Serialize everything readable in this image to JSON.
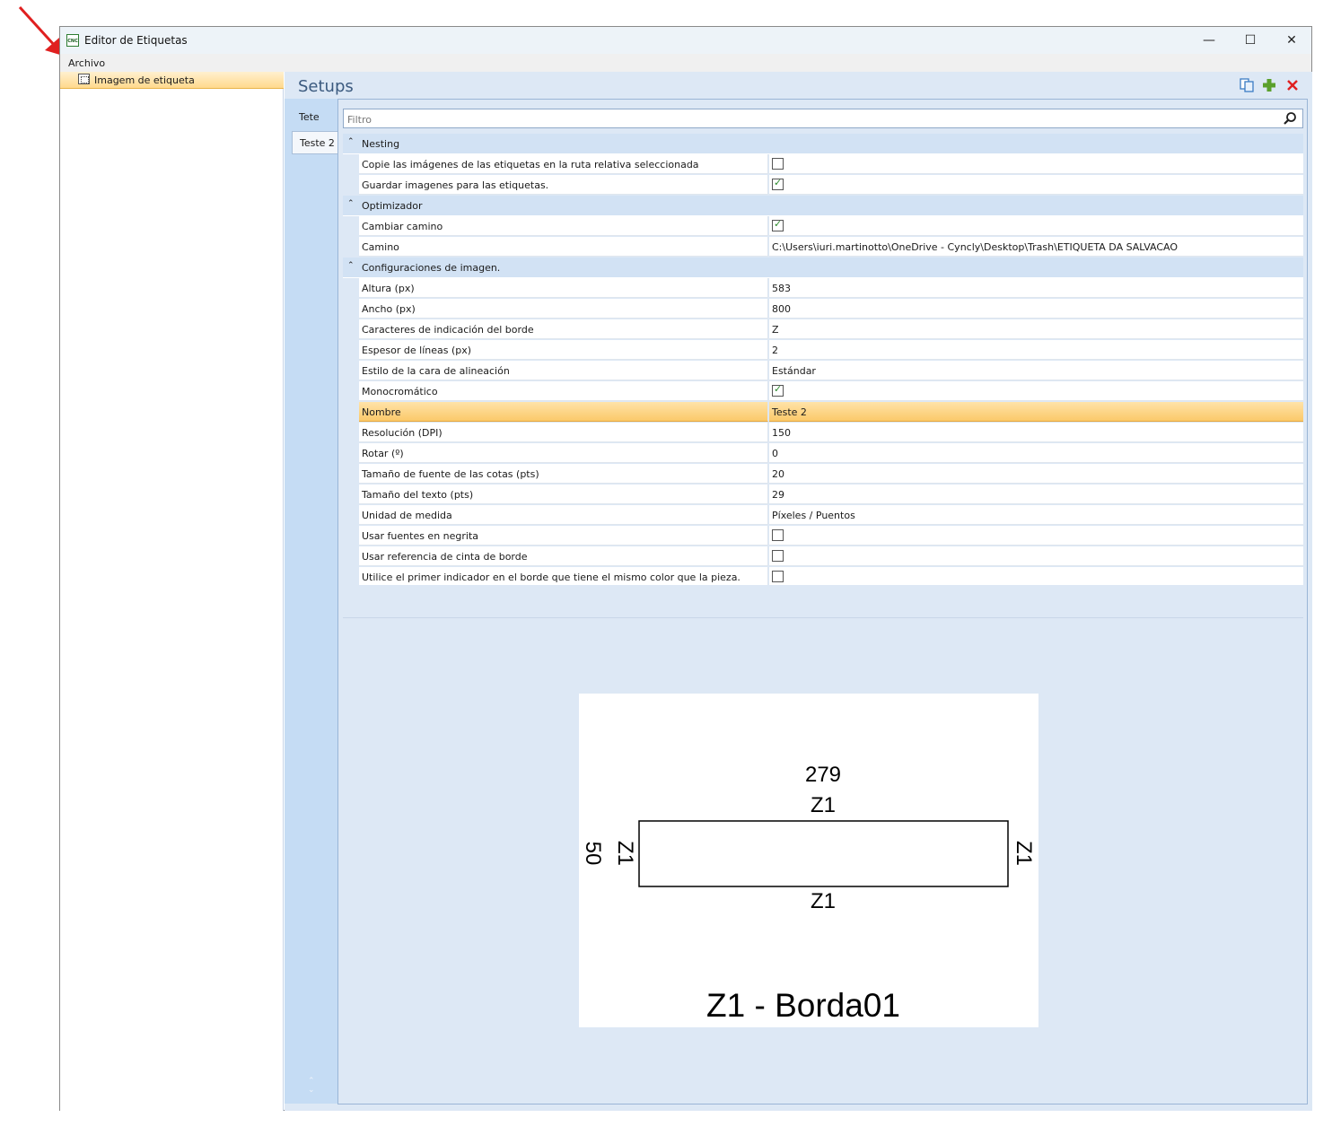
{
  "window": {
    "title": "Editor de Etiquetas",
    "app_icon_text": "CNC",
    "controls": {
      "minimize": "—",
      "maximize": "☐",
      "close": "✕"
    }
  },
  "menu": {
    "items": [
      "Archivo"
    ]
  },
  "tree": {
    "items": [
      {
        "label": "Imagem de etiqueta"
      }
    ]
  },
  "header": {
    "title": "Setups"
  },
  "tabs": [
    {
      "label": "Tete"
    },
    {
      "label": "Teste 2",
      "active": true
    }
  ],
  "filter": {
    "placeholder": "Filtro"
  },
  "categories": [
    {
      "label": "Nesting",
      "rows": [
        {
          "name": "Copie las imágenes de las etiquetas en la ruta relativa seleccionada",
          "checkbox": false
        },
        {
          "name": "Guardar imagenes para las etiquetas.",
          "checkbox": true
        }
      ]
    },
    {
      "label": "Optimizador",
      "rows": [
        {
          "name": "Cambiar camino",
          "checkbox": true
        },
        {
          "name": "Camino",
          "value": "C:\\Users\\iuri.martinotto\\OneDrive - Cyncly\\Desktop\\Trash\\ETIQUETA DA SALVACAO"
        }
      ]
    },
    {
      "label": "Configuraciones de imagen.",
      "rows": [
        {
          "name": "Altura (px)",
          "value": "583"
        },
        {
          "name": "Ancho (px)",
          "value": "800"
        },
        {
          "name": "Caracteres de indicación del borde",
          "value": "Z"
        },
        {
          "name": "Espesor de líneas (px)",
          "value": "2"
        },
        {
          "name": "Estilo de la cara de alineación",
          "value": "Estándar"
        },
        {
          "name": "Monocromático",
          "checkbox": true
        },
        {
          "name": "Nombre",
          "value": "Teste 2",
          "selected": true
        },
        {
          "name": "Resolución (DPI)",
          "value": "150"
        },
        {
          "name": "Rotar (º)",
          "value": "0"
        },
        {
          "name": "Tamaño de fuente de las cotas (pts)",
          "value": "20"
        },
        {
          "name": "Tamaño del texto (pts)",
          "value": "29"
        },
        {
          "name": "Unidad de medida",
          "value": "Píxeles / Puentos"
        },
        {
          "name": "Usar fuentes en negrita",
          "checkbox": false
        },
        {
          "name": "Usar referencia de cinta de borde",
          "checkbox": false
        },
        {
          "name": "Utilice el primer indicador en el borde que tiene el mismo color que la pieza.",
          "checkbox": false
        }
      ]
    }
  ],
  "preview": {
    "top_dimension": "279",
    "side_dimension": "50",
    "edge_top": "Z1",
    "edge_bottom": "Z1",
    "edge_left": "Z1",
    "edge_right": "Z1",
    "caption": "Z1 - Borda01"
  },
  "colors": {
    "selection": "#fbc96a",
    "pane_background": "#dde8f5",
    "arrow": "#e02020",
    "add_icon": "#5aa02c",
    "delete_icon": "#e02020"
  }
}
